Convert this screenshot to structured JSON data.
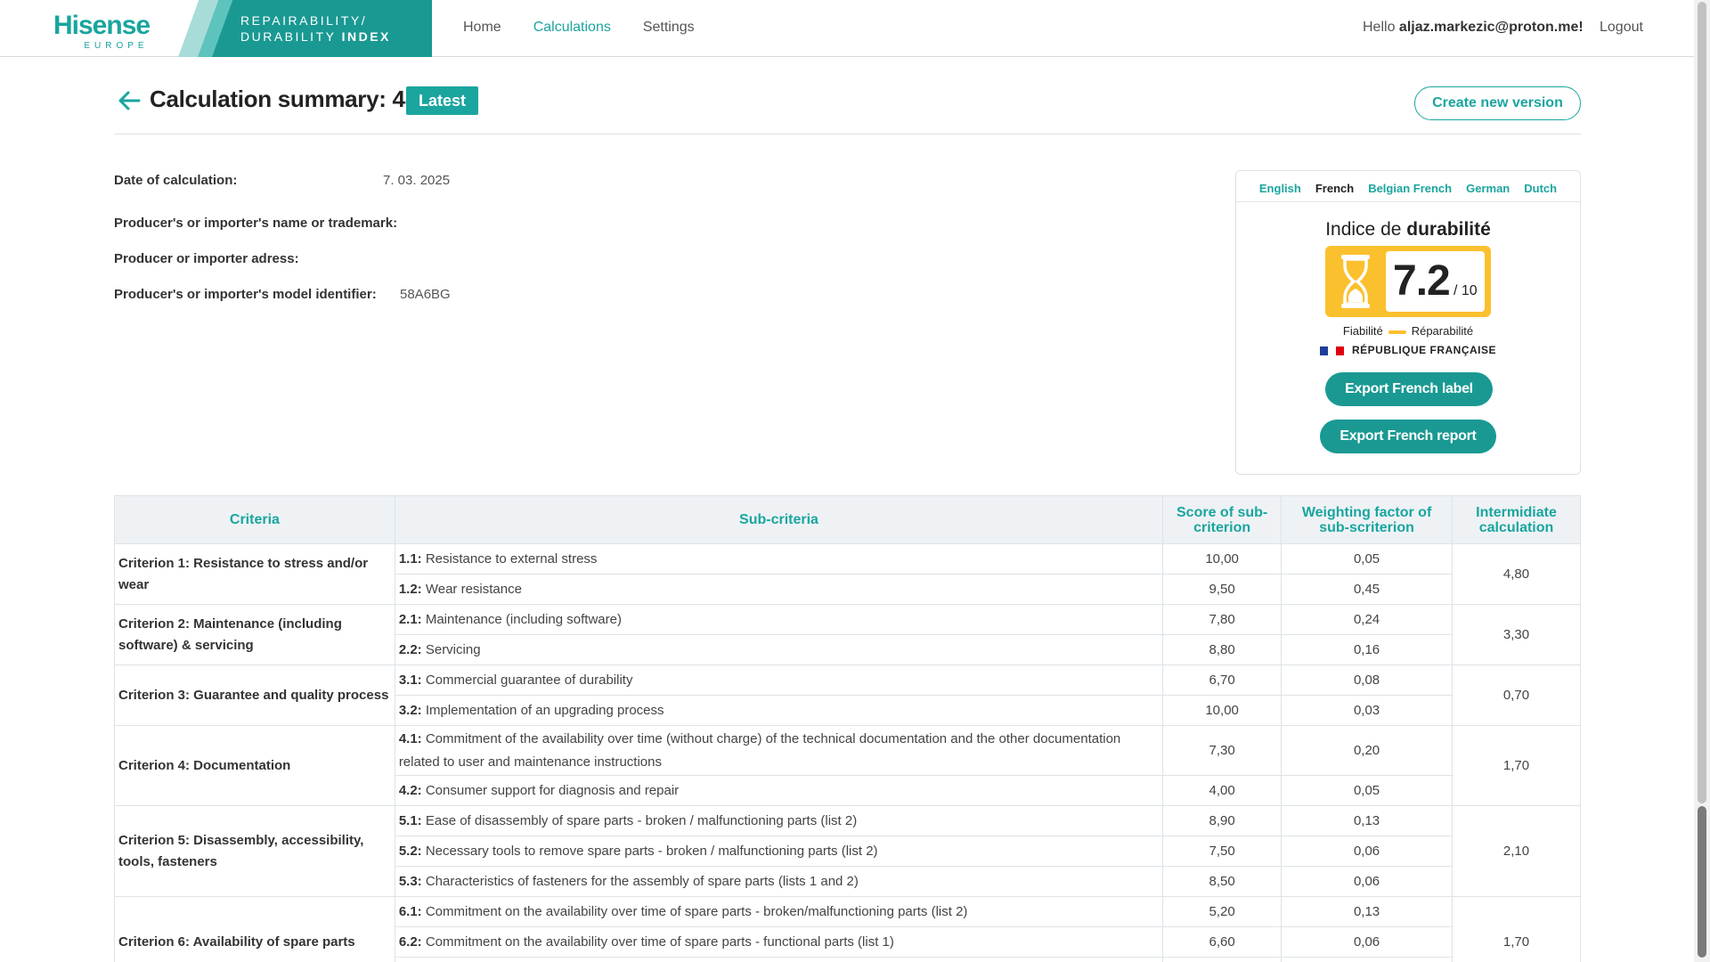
{
  "brand": {
    "logo_text": "Hisense",
    "logo_sub": "EUROPE",
    "banner_line1": "REPAIRABILITY/",
    "banner_line2_a": "DURABILITY",
    "banner_line2_b": "INDEX"
  },
  "nav": {
    "home": "Home",
    "calculations": "Calculations",
    "settings": "Settings"
  },
  "user": {
    "greeting": "Hello",
    "email": "aljaz.markezic@proton.me!",
    "logout": "Logout"
  },
  "header": {
    "title": "Calculation summary: 48",
    "badge": "Latest",
    "create_button": "Create new version"
  },
  "info": {
    "date_label": "Date of calculation:",
    "date_value": "7. 03. 2025",
    "producer_name_label": "Producer's or importer's name or trademark:",
    "producer_address_label": "Producer or importer adress:",
    "model_label": "Producer's or importer's model identifier:",
    "model_value": "58A6BG"
  },
  "label_card": {
    "languages": [
      "English",
      "French",
      "Belgian French",
      "German",
      "Dutch"
    ],
    "active_language": "French",
    "title_a": "Indice de",
    "title_b": "durabilité",
    "score": "7.2",
    "score_max": "/ 10",
    "legend_left": "Fiabilité",
    "legend_right": "Réparabilité",
    "republic": "RÉPUBLIQUE FRANÇAISE",
    "export_label": "Export French label",
    "export_report": "Export French report",
    "colors": {
      "score_bg": "#fbc02d",
      "accent": "#1aa59f"
    }
  },
  "table": {
    "headers": {
      "criteria": "Criteria",
      "sub": "Sub-criteria",
      "score": "Score of sub-criterion",
      "weight": "Weighting factor of sub-scriterion",
      "intermediate": "Intermidiate calculation"
    },
    "groups": [
      {
        "criterion": "Criterion 1: Resistance to stress and/or wear",
        "intermediate": "4,80",
        "rows": [
          {
            "code": "1.1:",
            "text": "Resistance to external stress",
            "score": "10,00",
            "weight": "0,05"
          },
          {
            "code": "1.2:",
            "text": "Wear resistance",
            "score": "9,50",
            "weight": "0,45"
          }
        ]
      },
      {
        "criterion": "Criterion 2: Maintenance (including software) & servicing",
        "intermediate": "3,30",
        "rows": [
          {
            "code": "2.1:",
            "text": "Maintenance (including software)",
            "score": "7,80",
            "weight": "0,24"
          },
          {
            "code": "2.2:",
            "text": "Servicing",
            "score": "8,80",
            "weight": "0,16"
          }
        ]
      },
      {
        "criterion": "Criterion 3: Guarantee and quality process",
        "intermediate": "0,70",
        "rows": [
          {
            "code": "3.1:",
            "text": "Commercial guarantee of durability",
            "score": "6,70",
            "weight": "0,08"
          },
          {
            "code": "3.2:",
            "text": "Implementation of an upgrading process",
            "score": "10,00",
            "weight": "0,03"
          }
        ]
      },
      {
        "criterion": "Criterion 4: Documentation",
        "intermediate": "1,70",
        "rows": [
          {
            "code": "4.1:",
            "text": "Commitment of the availability over time (without charge) of the technical documentation and the other documentation related to user and maintenance instructions",
            "score": "7,30",
            "weight": "0,20"
          },
          {
            "code": "4.2:",
            "text": "Consumer support for diagnosis and repair",
            "score": "4,00",
            "weight": "0,05"
          }
        ]
      },
      {
        "criterion": "Criterion 5: Disassembly, accessibility, tools, fasteners",
        "intermediate": "2,10",
        "rows": [
          {
            "code": "5.1:",
            "text": "Ease of disassembly of spare parts - broken / malfunctioning parts (list 2)",
            "score": "8,90",
            "weight": "0,13"
          },
          {
            "code": "5.2:",
            "text": "Necessary tools to remove spare parts - broken / malfunctioning parts (list 2)",
            "score": "7,50",
            "weight": "0,06"
          },
          {
            "code": "5.3:",
            "text": "Characteristics of fasteners for the assembly of spare parts (lists 1 and 2)",
            "score": "8,50",
            "weight": "0,06"
          }
        ]
      },
      {
        "criterion": "Criterion 6: Availability of spare parts",
        "intermediate": "1,70",
        "rows": [
          {
            "code": "6.1:",
            "text": "Commitment on the availability over time of spare parts - broken/malfunctioning parts (list 2)",
            "score": "5,20",
            "weight": "0,13"
          },
          {
            "code": "6.2:",
            "text": "Commitment on the availability over time of spare parts - functional parts (list 1)",
            "score": "6,60",
            "weight": "0,06"
          },
          {
            "code": "",
            "text": "",
            "score": "",
            "weight": ""
          }
        ]
      }
    ]
  }
}
